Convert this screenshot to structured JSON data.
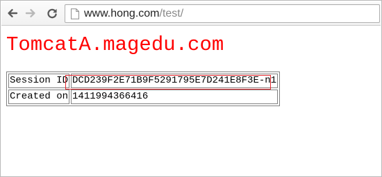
{
  "browser": {
    "url_host": "www.hong.com",
    "url_path": "/test/",
    "icons": {
      "back": "back-arrow-icon",
      "forward": "forward-arrow-icon",
      "reload": "reload-icon",
      "page": "page-icon"
    }
  },
  "page": {
    "heading": "TomcatA.magedu.com",
    "heading_color": "#ff0000",
    "rows": [
      {
        "label": "Session ID",
        "value": "DCD239F2E71B9F5291795E7D241E8F3E-n1"
      },
      {
        "label": "Created on",
        "value": "1411994366416"
      }
    ],
    "highlight_color": "#e3262d"
  }
}
